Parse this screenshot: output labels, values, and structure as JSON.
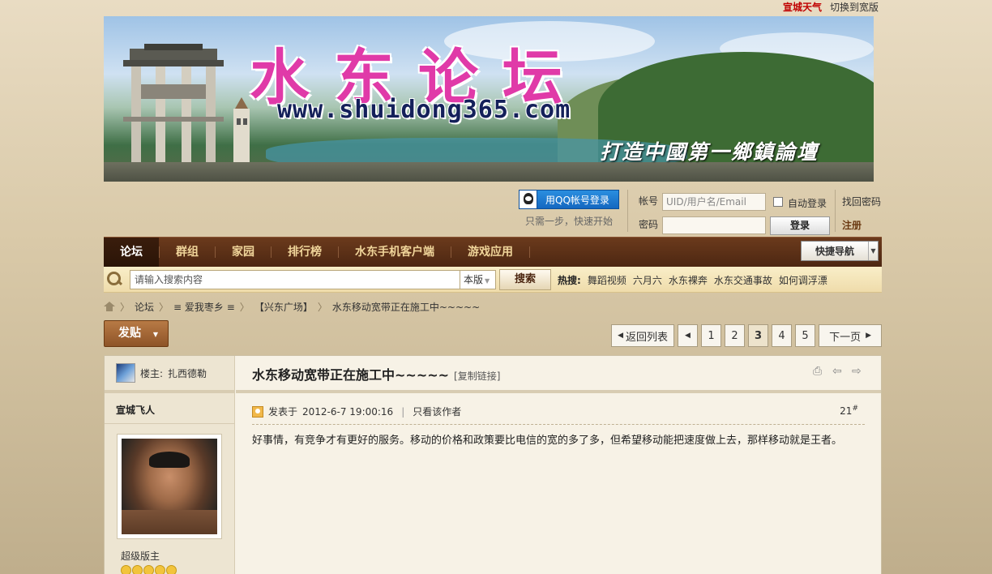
{
  "topbar": {
    "weather": "宣城天气",
    "switch_wide": "切换到宽版"
  },
  "banner": {
    "title": "水东论坛",
    "url": "www.shuidong365.com",
    "slogan": "打造中國第一鄉鎮論壇"
  },
  "login": {
    "qq_label": "用QQ帐号登录",
    "qq_hint": "只需一步，快速开始",
    "account_label": "帐号",
    "account_placeholder": "UID/用户名/Email",
    "password_label": "密码",
    "auto_login": "自动登录",
    "login_button": "登录",
    "forgot": "找回密码",
    "register": "注册"
  },
  "nav": {
    "items": [
      "论坛",
      "群组",
      "家园",
      "排行榜",
      "水东手机客户端",
      "游戏应用"
    ],
    "quick_nav": "快捷导航"
  },
  "search": {
    "placeholder": "请输入搜索内容",
    "scope": "本版",
    "button": "搜索",
    "hot_label": "热搜:",
    "hot_terms": [
      "舞蹈视频",
      "六月六",
      "水东裸奔",
      "水东交通事故",
      "如何调浮漂"
    ]
  },
  "breadcrumb": [
    "论坛",
    "≡ 爱我枣乡 ≡",
    "【兴东广场】",
    "水东移动宽带正在施工中~~~~~"
  ],
  "post_button": "发贴",
  "pager": {
    "back": "返回列表",
    "pages": [
      "1",
      "2",
      "3",
      "4",
      "5"
    ],
    "current": "3",
    "next": "下一页"
  },
  "thread": {
    "op_label": "楼主:",
    "op_name": "扎西德勒",
    "title": "水东移动宽带正在施工中~~~~~",
    "copy_link": "[复制链接]",
    "author": "宣城飞人",
    "rank": "超级版主",
    "posted_prefix": "发表于",
    "posted_time": "2012-6-7 19:00:16",
    "only_author": "只看该作者",
    "floor": "21",
    "floor_sup": "#",
    "content": "好事情，有竞争才有更好的服务。移动的价格和政策要比电信的宽的多了多，但希望移动能把速度做上去，那样移动就是王者。"
  },
  "colors": {
    "nav_bg": "#5a2f17",
    "nav_text": "#f0d59a",
    "brand_pink": "#e03aa8",
    "weather_red": "#c00000"
  }
}
